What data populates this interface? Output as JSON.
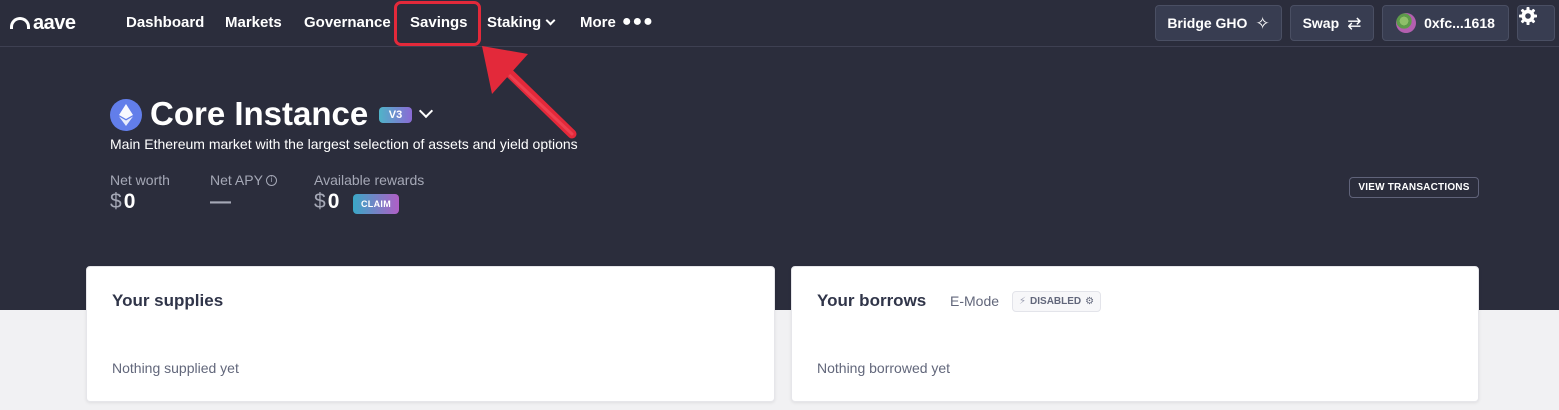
{
  "brand": {
    "logo_text": "aave"
  },
  "nav": {
    "items": [
      {
        "label": "Dashboard"
      },
      {
        "label": "Markets"
      },
      {
        "label": "Governance"
      },
      {
        "label": "Savings"
      },
      {
        "label": "Staking"
      },
      {
        "label": "More"
      }
    ],
    "bridge_label": "Bridge GHO",
    "swap_label": "Swap",
    "wallet_label": "0xfc...1618",
    "settings_icon": "gear-icon"
  },
  "market": {
    "title": "Core Instance",
    "version_badge": "V3",
    "subtitle": "Main Ethereum market with the largest selection of assets and yield options",
    "icon": "ethereum-icon"
  },
  "stats": {
    "net_worth": {
      "label": "Net worth",
      "currency": "$",
      "value": "0"
    },
    "net_apy": {
      "label": "Net APY",
      "value": "—"
    },
    "rewards": {
      "label": "Available rewards",
      "currency": "$",
      "value": "0",
      "claim_label": "CLAIM"
    }
  },
  "view_transactions_label": "VIEW TRANSACTIONS",
  "supplies": {
    "title": "Your supplies",
    "empty_text": "Nothing supplied yet"
  },
  "borrows": {
    "title": "Your borrows",
    "emode_label": "E-Mode",
    "emode_status": "DISABLED",
    "empty_text": "Nothing borrowed yet"
  },
  "colors": {
    "nav_bg": "#2b2d3c",
    "highlight": "#e3293a",
    "page_bg": "#f1f1f3",
    "card_bg": "#ffffff"
  }
}
